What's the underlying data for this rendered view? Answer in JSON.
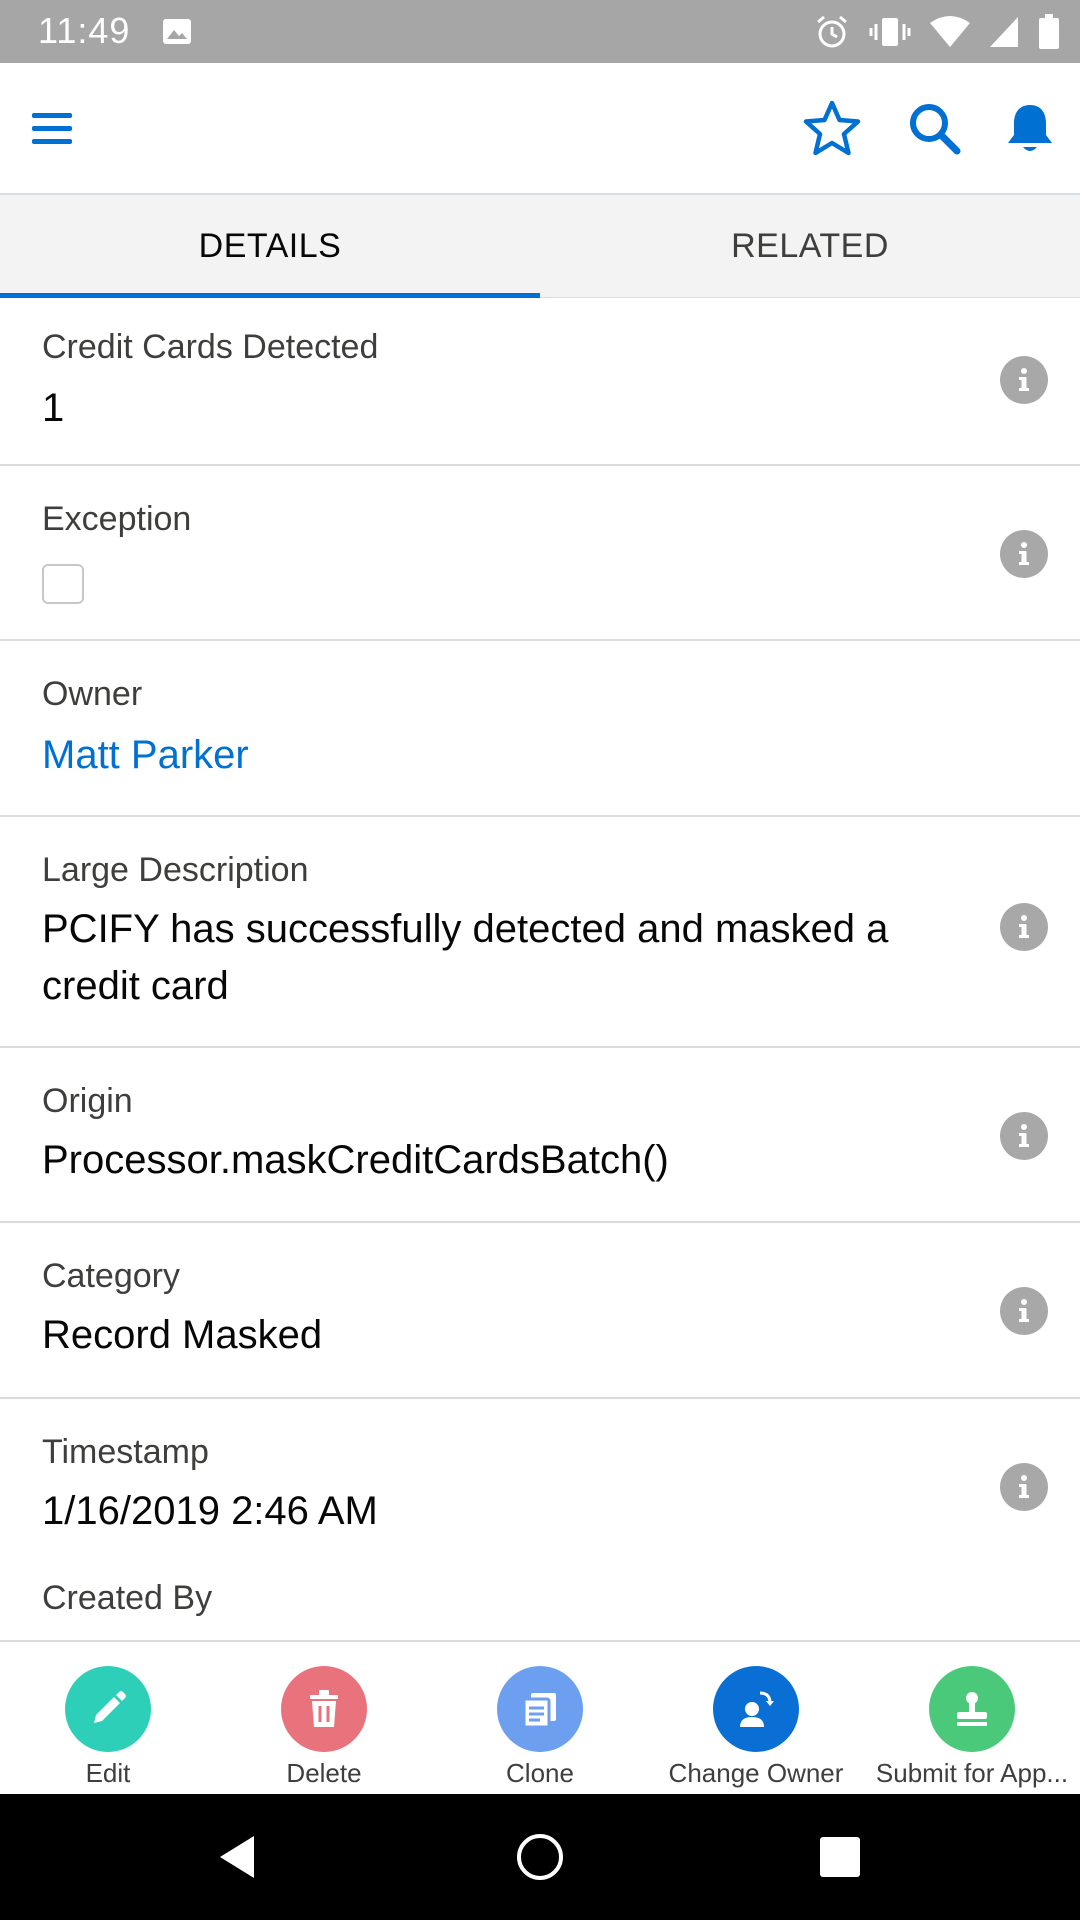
{
  "status_bar": {
    "time": "11:49"
  },
  "header": {
    "icons": [
      "menu-icon",
      "star-icon",
      "search-icon",
      "bell-icon"
    ],
    "accent_color": "#0070d2"
  },
  "tabs": [
    {
      "label": "DETAILS",
      "active": true
    },
    {
      "label": "RELATED",
      "active": false
    }
  ],
  "fields": [
    {
      "label": "Credit Cards Detected",
      "value": "1"
    },
    {
      "label": "Exception",
      "checked": false
    },
    {
      "label": "Owner",
      "value": "Matt Parker"
    },
    {
      "label": "Large Description",
      "value": "PCIFY has successfully detected and masked a credit card"
    },
    {
      "label": "Origin",
      "value": "Processor.maskCreditCardsBatch()"
    },
    {
      "label": "Category",
      "value": "Record Masked"
    },
    {
      "label": "Timestamp",
      "value": "1/16/2019 2:46 AM"
    },
    {
      "label": "Created By"
    }
  ],
  "actions": [
    {
      "label": "Edit",
      "icon": "pencil-icon",
      "color": "#2ecfb9"
    },
    {
      "label": "Delete",
      "icon": "trash-icon",
      "color": "#e8737d"
    },
    {
      "label": "Clone",
      "icon": "clone-icon",
      "color": "#6d9ff0"
    },
    {
      "label": "Change Owner",
      "icon": "change-owner-icon",
      "color": "#0a6fd4"
    },
    {
      "label": "Submit for App...",
      "icon": "stamp-icon",
      "color": "#4bc97b"
    }
  ]
}
